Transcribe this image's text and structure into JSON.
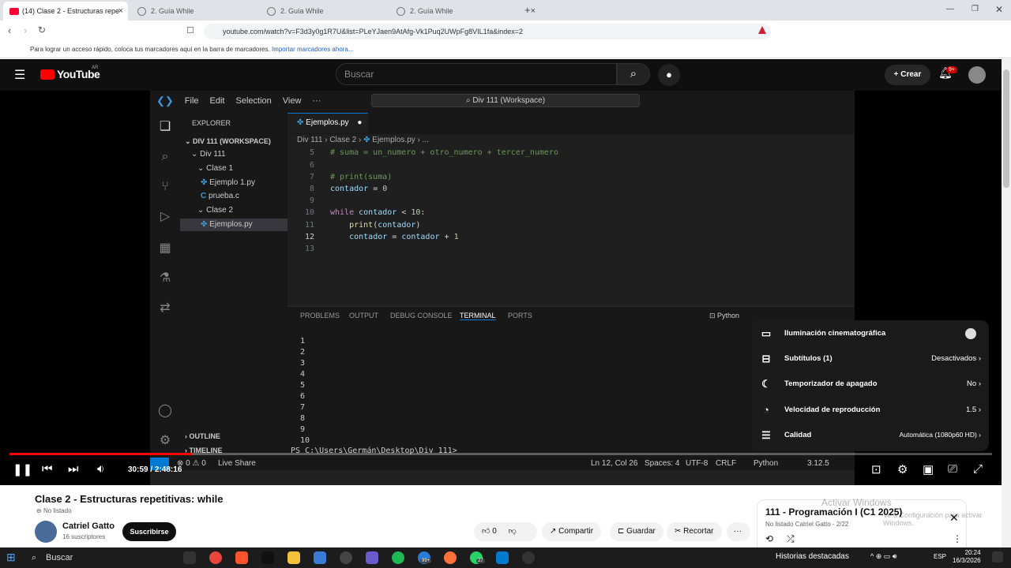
{
  "browser": {
    "tabs": [
      {
        "label": "(14) Clase 2 - Estructuras repe"
      },
      {
        "label": "2. Guía While"
      },
      {
        "label": "2. Guía While"
      },
      {
        "label": "2. Guía While"
      }
    ],
    "url": "youtube.com/watch?v=F3d3y0g1R7U&list=PLeYJaen9AtAfg-Vk1Puq2UWpFg8VIL1fa&index=2",
    "bookmarks_text": "Para lograr un acceso rápido, coloca tus marcadores aquí en la barra de marcadores.",
    "bookmarks_link": "Importar marcadores ahora..."
  },
  "youtube": {
    "logo": "YouTube",
    "region": "AR",
    "search_placeholder": "Buscar",
    "create_label": "Crear",
    "notif_badge": "9+"
  },
  "vscode": {
    "menu": [
      "File",
      "Edit",
      "Selection",
      "View",
      "···"
    ],
    "command_center": "Div 111 (Workspace)",
    "explorer_title": "EXPLORER",
    "workspace": "DIV 111 (WORKSPACE)",
    "tree": [
      {
        "label": "Div 111",
        "kind": "folder"
      },
      {
        "label": "Clase 1",
        "kind": "folder"
      },
      {
        "label": "Ejemplo 1.py",
        "kind": "py"
      },
      {
        "label": "prueba.c",
        "kind": "c"
      },
      {
        "label": "Clase 2",
        "kind": "folder"
      },
      {
        "label": "Ejemplos.py",
        "kind": "py"
      }
    ],
    "outline": "OUTLINE",
    "timeline": "TIMELINE",
    "editor_tab": "Ejemplos.py",
    "breadcrumb": [
      "Div 111",
      "Clase 2",
      "Ejemplos.py",
      "..."
    ],
    "line_numbers": [
      "5",
      "6",
      "7",
      "8",
      "9",
      "10",
      "11",
      "12",
      "13"
    ],
    "panel_tabs": [
      "PROBLEMS",
      "OUTPUT",
      "DEBUG CONSOLE",
      "TERMINAL",
      "PORTS"
    ],
    "terminal_kind": "Python",
    "terminal_lines": [
      "1",
      "2",
      "3",
      "4",
      "5",
      "6",
      "7",
      "8",
      "9",
      "10"
    ],
    "prompt": "PS C:\\Users\\Germán\\Desktop\\Div 111>",
    "status": {
      "errors": "0",
      "warnings": "0",
      "live_share": "Live Share",
      "position": "Ln 12, Col 26",
      "spaces": "Spaces: 4",
      "encoding": "UTF-8",
      "eol": "CRLF",
      "language": "Python",
      "version": "3.12.5"
    }
  },
  "player": {
    "time": "30:59 / 2:48:16",
    "progress_fraction": 0.186,
    "settings": [
      {
        "label": "Iluminación cinematográfica",
        "value": ""
      },
      {
        "label": "Subtítulos (1)",
        "value": "Desactivados"
      },
      {
        "label": "Temporizador de apagado",
        "value": "No"
      },
      {
        "label": "Velocidad de reproducción",
        "value": "1.5"
      },
      {
        "label": "Calidad",
        "value": "Automática (1080p60 HD)"
      }
    ]
  },
  "video_info": {
    "title": "Clase 2 - Estructuras repetitivas: while",
    "visibility": "No listado",
    "channel": "Catriel Gatto",
    "subscribers": "16 suscriptores",
    "subscribe": "Suscribirse",
    "likes": "0",
    "share": "Compartir",
    "save": "Guardar",
    "clip": "Recortar"
  },
  "playlist": {
    "title": "111 - Programación I (C1 2025)",
    "meta": "No listado Catriel Gatto - 2/22"
  },
  "windows": {
    "activate_title": "Activar Windows",
    "activate_sub": "Ve a Configuración para activar Windows.",
    "taskbar_search": "Buscar",
    "news": "Historias destacadas",
    "lang": "ESP",
    "time": "20:24",
    "date": "16/3/2026",
    "badge_a": "99+",
    "badge_b": "27"
  }
}
